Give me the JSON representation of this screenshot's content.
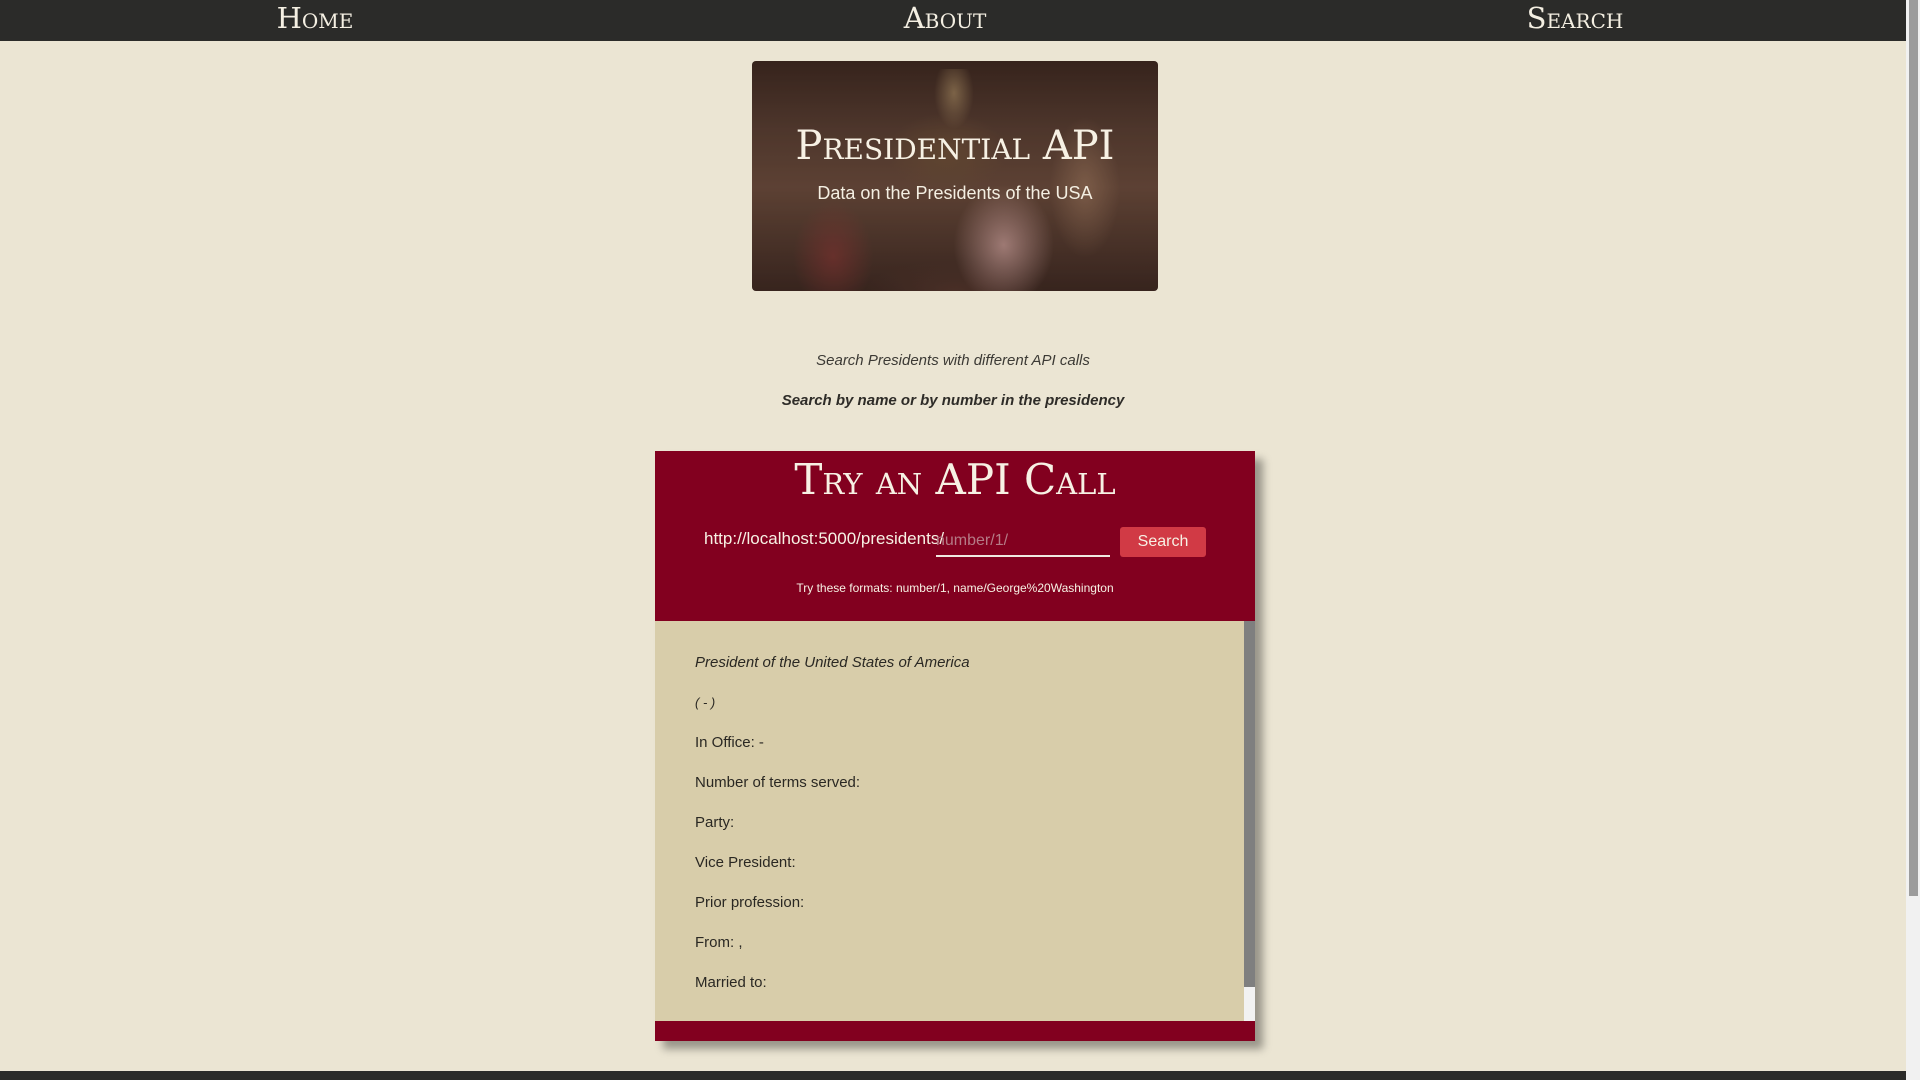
{
  "nav": {
    "home": "Home",
    "about": "About",
    "search": "Search"
  },
  "hero": {
    "title": "Presidential API",
    "subtitle": "Data on the Presidents of the USA"
  },
  "intro": {
    "line1": "Search Presidents with different API calls",
    "line2": "Search by name or by number in the presidency"
  },
  "api_card": {
    "title": "Try an API Call",
    "url_prefix": "http://localhost:5000/presidents/",
    "input_value": "",
    "input_placeholder": "number/1/",
    "search_button": "Search",
    "format_hint": "Try these formats: number/1, name/George%20Washington"
  },
  "result": {
    "title_line": "President of the United States of America",
    "dates": "( - )",
    "in_office": "In Office: -",
    "terms": "Number of terms served:",
    "party": "Party:",
    "vice_president": "Vice President:",
    "prior_profession": "Prior profession:",
    "from": "From: ,",
    "married_to": "Married to:"
  },
  "colors": {
    "navbar": "#2b2b29",
    "page_background": "#ebe5d3",
    "accent_burgundy": "#82001f",
    "button_red": "#d13a45",
    "result_panel": "#d8cdaa"
  }
}
